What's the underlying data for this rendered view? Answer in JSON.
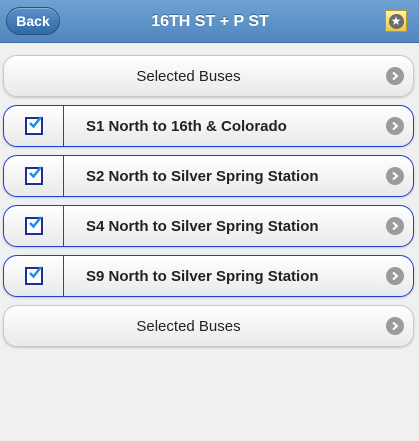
{
  "header": {
    "back_label": "Back",
    "title": "16TH ST + P ST",
    "favorite_icon": "star-icon"
  },
  "top_item": {
    "label": "Selected Buses",
    "icon": "chevron-right-icon"
  },
  "routes": [
    {
      "label": "S1 North to 16th & Colorado",
      "checked": true
    },
    {
      "label": "S2 North to Silver Spring Station",
      "checked": true
    },
    {
      "label": "S4 North to Silver Spring Station",
      "checked": true
    },
    {
      "label": "S9 North to Silver Spring Station",
      "checked": true
    }
  ],
  "bottom_item": {
    "label": "Selected Buses",
    "icon": "chevron-right-icon"
  },
  "colors": {
    "header": "#5b8fc6",
    "selected_border": "#1f3fd6",
    "checkmark": "#1f8fe0"
  }
}
